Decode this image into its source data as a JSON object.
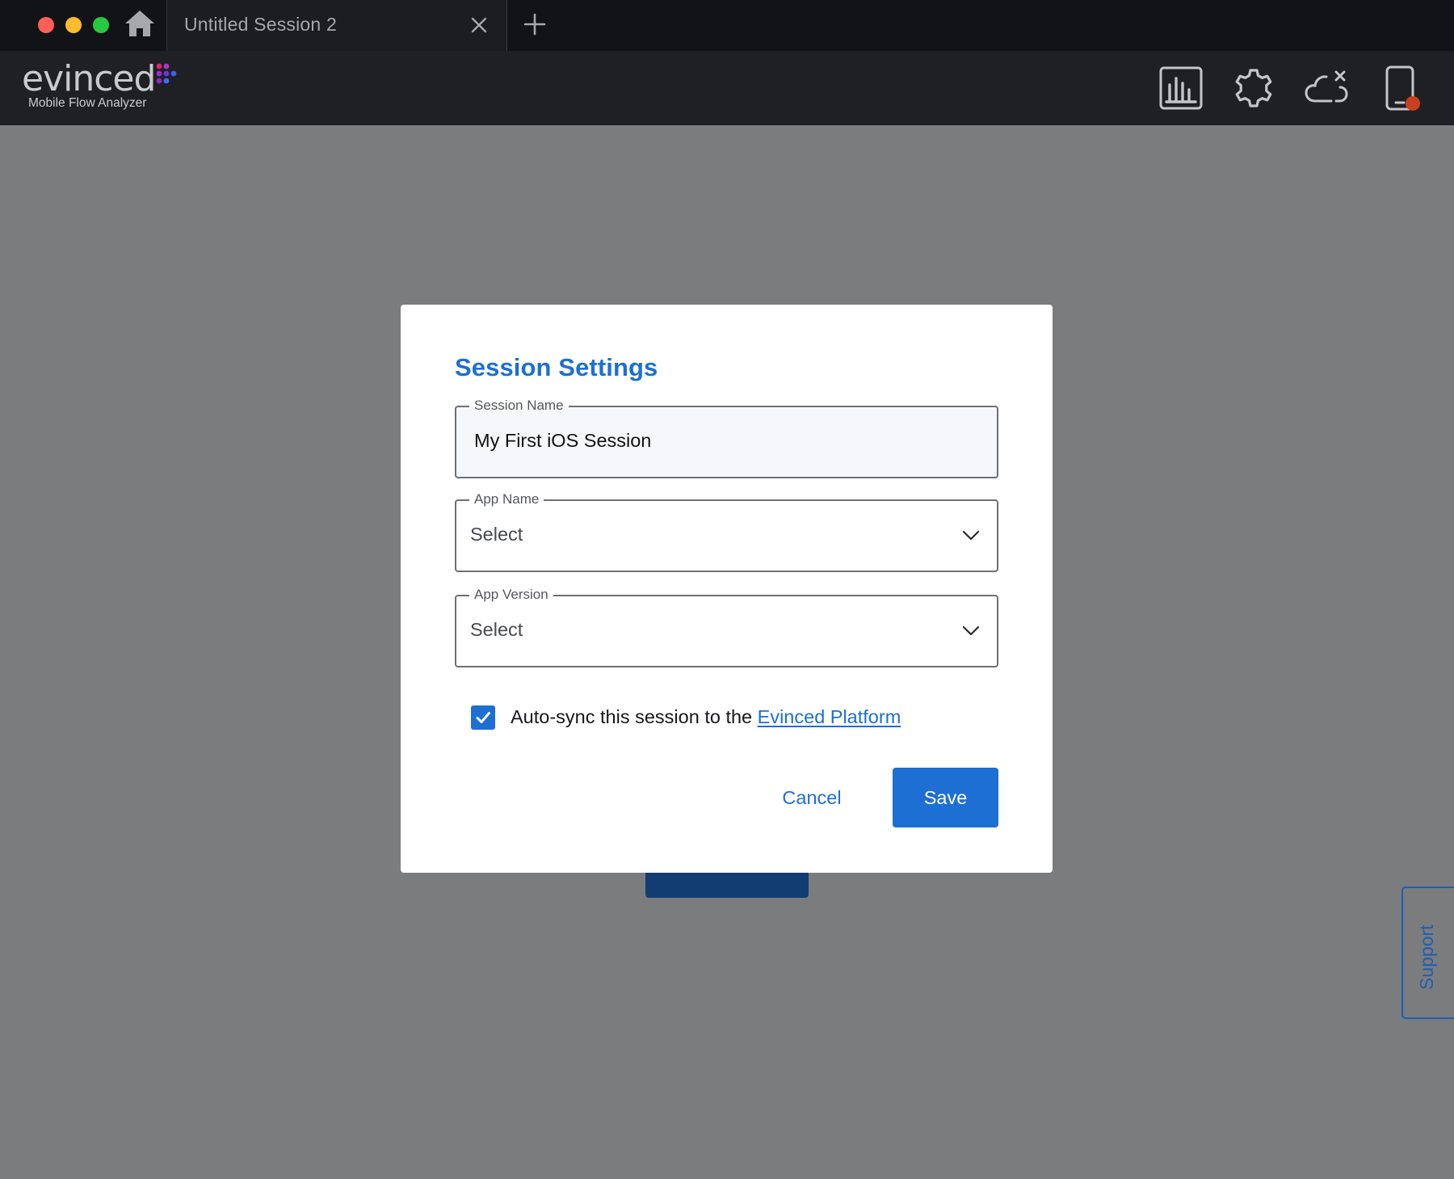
{
  "window": {
    "tab_title": "Untitled Session 2"
  },
  "header": {
    "logo_text": "evinced",
    "logo_subtitle": "Mobile Flow Analyzer"
  },
  "icons": {
    "home": "home-icon",
    "close_tab": "close-icon",
    "new_tab": "plus-icon",
    "analytics": "bar-chart-icon",
    "settings": "gear-icon",
    "cloud_sync": "cloud-off-icon",
    "device": "mobile-device-icon"
  },
  "dialog": {
    "title": "Session Settings",
    "session_name": {
      "label": "Session Name",
      "value": "My First iOS Session"
    },
    "app_name": {
      "label": "App Name",
      "value": "Select"
    },
    "app_version": {
      "label": "App Version",
      "value": "Select"
    },
    "auto_sync": {
      "checked": true,
      "label": "Auto-sync this session to the ",
      "link_text": "Evinced Platform"
    },
    "cancel_label": "Cancel",
    "save_label": "Save"
  },
  "support_label": "Support",
  "colors": {
    "accent": "#1d6fd3",
    "titlebar_bg": "#121316",
    "header_bg": "#1f2024",
    "overlay_bg": "#7b7c7e",
    "device_status_dot": "#c8401f"
  }
}
